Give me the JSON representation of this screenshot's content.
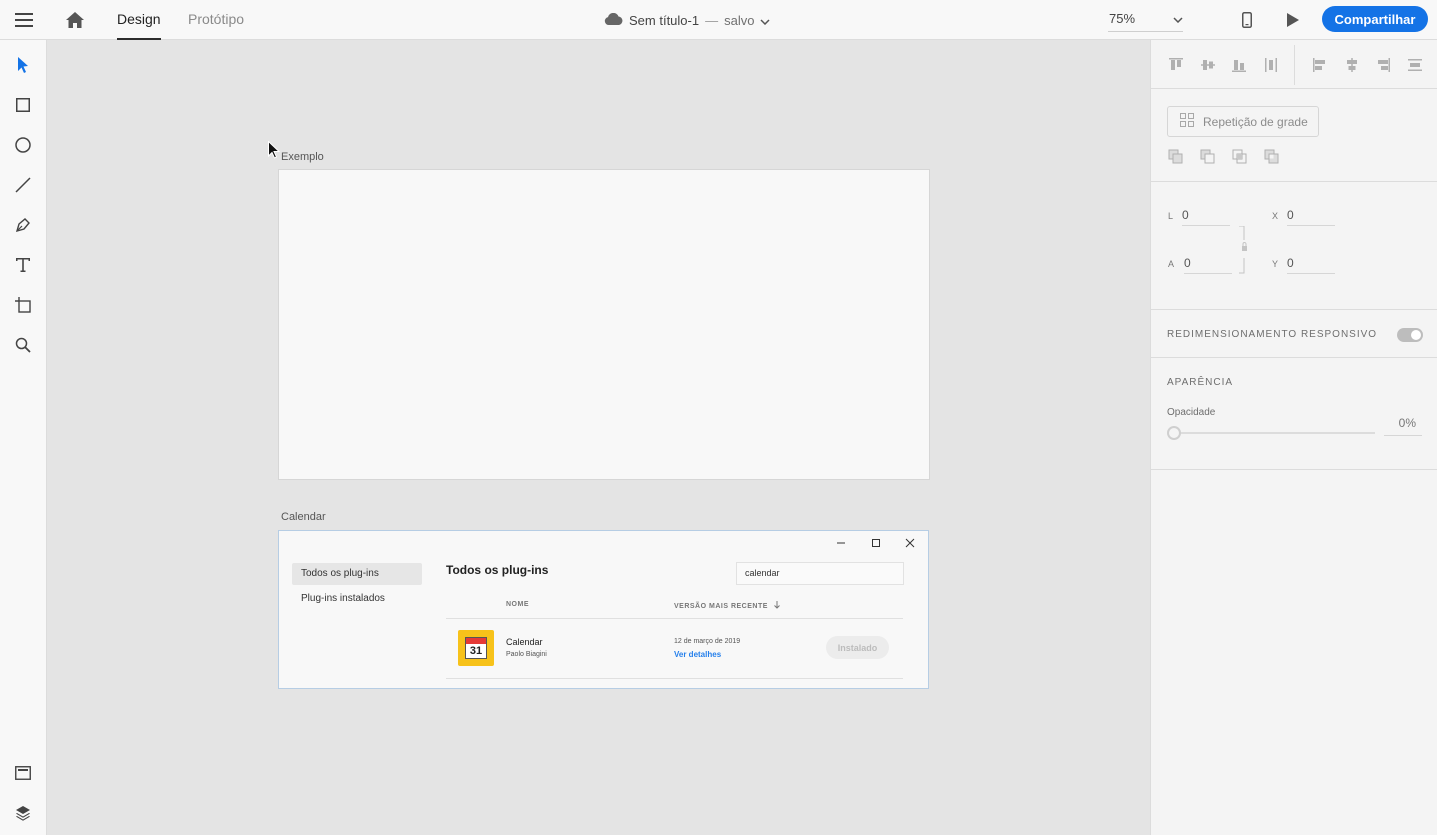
{
  "topbar": {
    "tabs": [
      {
        "label": "Design",
        "active": true
      },
      {
        "label": "Protótipo",
        "active": false
      }
    ],
    "document": {
      "title": "Sem título-1",
      "separator": "—",
      "status": "salvo"
    },
    "zoom": "75%",
    "share_label": "Compartilhar",
    "icons": [
      "menu-icon",
      "home-icon",
      "cloud-icon",
      "chevron-down-icon",
      "mobile-preview-icon",
      "play-icon"
    ]
  },
  "tools": [
    "select-icon",
    "rectangle-icon",
    "ellipse-icon",
    "line-icon",
    "pen-icon",
    "text-icon",
    "artboard-icon",
    "zoom-icon",
    "assets-icon",
    "layers-icon"
  ],
  "canvas": {
    "artboards": [
      {
        "label": "Exemplo"
      },
      {
        "label": "Calendar"
      }
    ],
    "plugin_window": {
      "sidebar": [
        "Todos os plug-ins",
        "Plug-ins instalados"
      ],
      "heading": "Todos os plug-ins",
      "search_value": "calendar",
      "columns": {
        "name": "NOME",
        "version": "VERSÃO MAIS RECENTE"
      },
      "row": {
        "icon_day": "31",
        "name": "Calendar",
        "author": "Paolo Biagini",
        "date": "12 de março de 2019",
        "details_link": "Ver detalhes",
        "button": "Instalado"
      }
    }
  },
  "panel": {
    "grid_repeat_label": "Repetição de grade",
    "fields": {
      "w_label": "L",
      "w_value": "0",
      "h_label": "A",
      "h_value": "0",
      "x_label": "X",
      "x_value": "0",
      "y_label": "Y",
      "y_value": "0"
    },
    "responsive_label": "REDIMENSIONAMENTO RESPONSIVO",
    "appearance_label": "APARÊNCIA",
    "opacity_label": "Opacidade",
    "opacity_value": "0%"
  },
  "colors": {
    "accent": "#1473e6",
    "select_tool": "#1473e6",
    "link": "#2680eb",
    "plugin_icon_bg": "#f7c21a"
  }
}
